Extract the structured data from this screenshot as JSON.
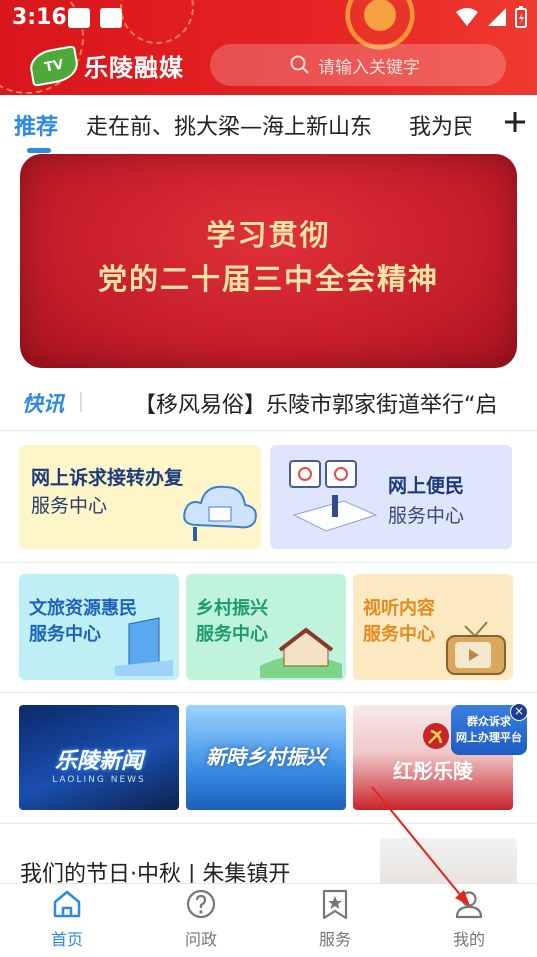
{
  "status_bar": {
    "time": "3:16"
  },
  "header": {
    "logo_mark": "TV",
    "app_name": "乐陵融媒",
    "search_placeholder": "请输入关键字"
  },
  "tabs": [
    "推荐",
    "走在前、挑大梁—海上新山东",
    "我为民企"
  ],
  "banner": {
    "line1": "学习贯彻",
    "line2": "党的二十届三中全会精神"
  },
  "ticker": {
    "tag": "快讯",
    "text": "【移风易俗】乐陵市郭家街道举行“启"
  },
  "services": {
    "card1": {
      "t1": "网上诉求接转办复",
      "t2": "服务中心"
    },
    "card2": {
      "t1": "网上便民",
      "t2": "服务中心"
    },
    "card3": {
      "t1": "文旅资源惠民",
      "t2": "服务中心"
    },
    "card4": {
      "t1": "乡村振兴",
      "t2": "服务中心"
    },
    "card5": {
      "t1": "视听内容",
      "t2": "服务中心"
    }
  },
  "media": {
    "m1": {
      "title": "乐陵新闻",
      "sub": "LAOLING NEWS"
    },
    "m2": {
      "title": "新時乡村振兴"
    },
    "m3": {
      "title": "红彤乐陵"
    }
  },
  "float_badge": {
    "line1": "群众诉求",
    "line2": "网上办理平台",
    "close": "×"
  },
  "article": {
    "title": "我们的节日·中秋 | 朱集镇开"
  },
  "nav": [
    "首页",
    "问政",
    "服务",
    "我的"
  ],
  "colors": {
    "accent": "#2a8ae6",
    "header_red": "#e52222"
  }
}
